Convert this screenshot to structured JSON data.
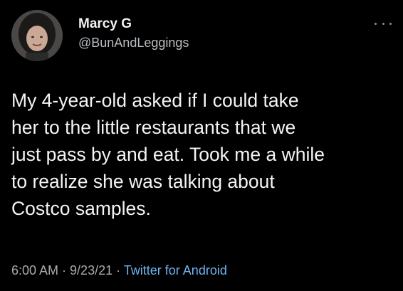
{
  "user": {
    "display_name": "Marcy G",
    "handle": "@BunAndLeggings",
    "avatar_icon": "profile-photo"
  },
  "tweet": {
    "lines": [
      "My 4-year-old asked if I could take",
      "her to the little restaurants that we",
      "just pass by and eat. Took me a while",
      "to realize she was talking about",
      "Costco samples."
    ]
  },
  "meta": {
    "time": "6:00 AM",
    "date": "9/23/21",
    "separator": " · ",
    "source": "Twitter for Android"
  },
  "colors": {
    "background": "#000000",
    "link": "#6fb4f0",
    "secondary_text": "#a6abb0"
  }
}
